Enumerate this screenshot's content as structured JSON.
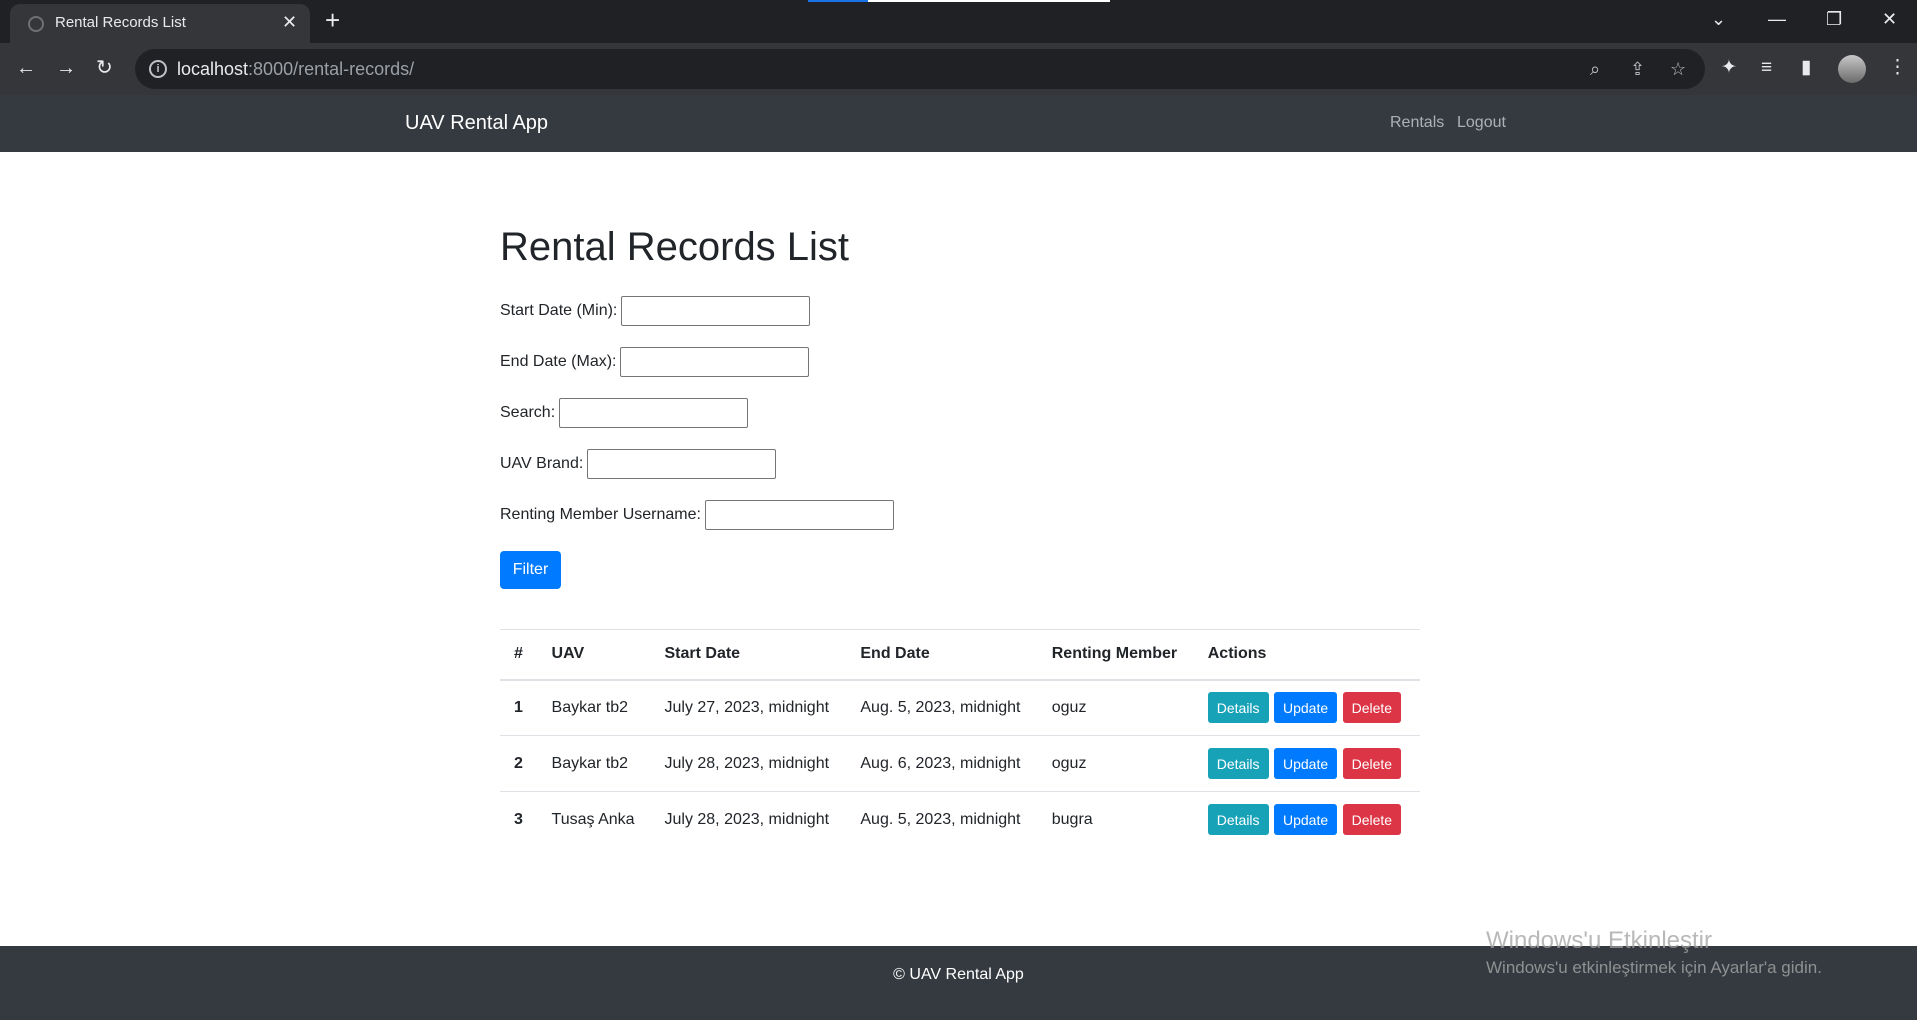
{
  "browser": {
    "tab_title": "Rental Records List",
    "tab_close": "✕",
    "new_tab": "+",
    "url_host": "localhost",
    "url_path": ":8000/rental-records/",
    "window_controls": {
      "dropdown": "⌄",
      "minimize": "—",
      "restore": "❐",
      "close": "✕"
    }
  },
  "navbar": {
    "brand": "UAV Rental App",
    "links": [
      "Rentals",
      "Logout"
    ]
  },
  "page": {
    "title": "Rental Records List"
  },
  "filters": {
    "start_date_label": "Start Date (Min):",
    "end_date_label": "End Date (Max):",
    "search_label": "Search:",
    "uav_brand_label": "UAV Brand:",
    "member_label": "Renting Member Username:",
    "start_date_value": "",
    "end_date_value": "",
    "search_value": "",
    "uav_brand_value": "",
    "member_value": "",
    "submit_label": "Filter"
  },
  "table": {
    "headers": [
      "#",
      "UAV",
      "Start Date",
      "End Date",
      "Renting Member",
      "Actions"
    ],
    "rows": [
      {
        "num": "1",
        "uav": "Baykar tb2",
        "start": "July 27, 2023, midnight",
        "end": "Aug. 5, 2023, midnight",
        "member": "oguz"
      },
      {
        "num": "2",
        "uav": "Baykar tb2",
        "start": "July 28, 2023, midnight",
        "end": "Aug. 6, 2023, midnight",
        "member": "oguz"
      },
      {
        "num": "3",
        "uav": "Tusaş Anka",
        "start": "July 28, 2023, midnight",
        "end": "Aug. 5, 2023, midnight",
        "member": "bugra"
      }
    ],
    "actions": {
      "details": "Details",
      "update": "Update",
      "delete": "Delete"
    }
  },
  "footer": {
    "text": "© UAV Rental App"
  },
  "watermark": {
    "title": "Windows'u Etkinleştir",
    "subtitle": "Windows'u etkinleştirmek için Ayarlar'a gidin."
  },
  "colors": {
    "navbar_bg": "#343a40",
    "primary": "#007bff",
    "info": "#17a2b8",
    "danger": "#dc3545"
  }
}
